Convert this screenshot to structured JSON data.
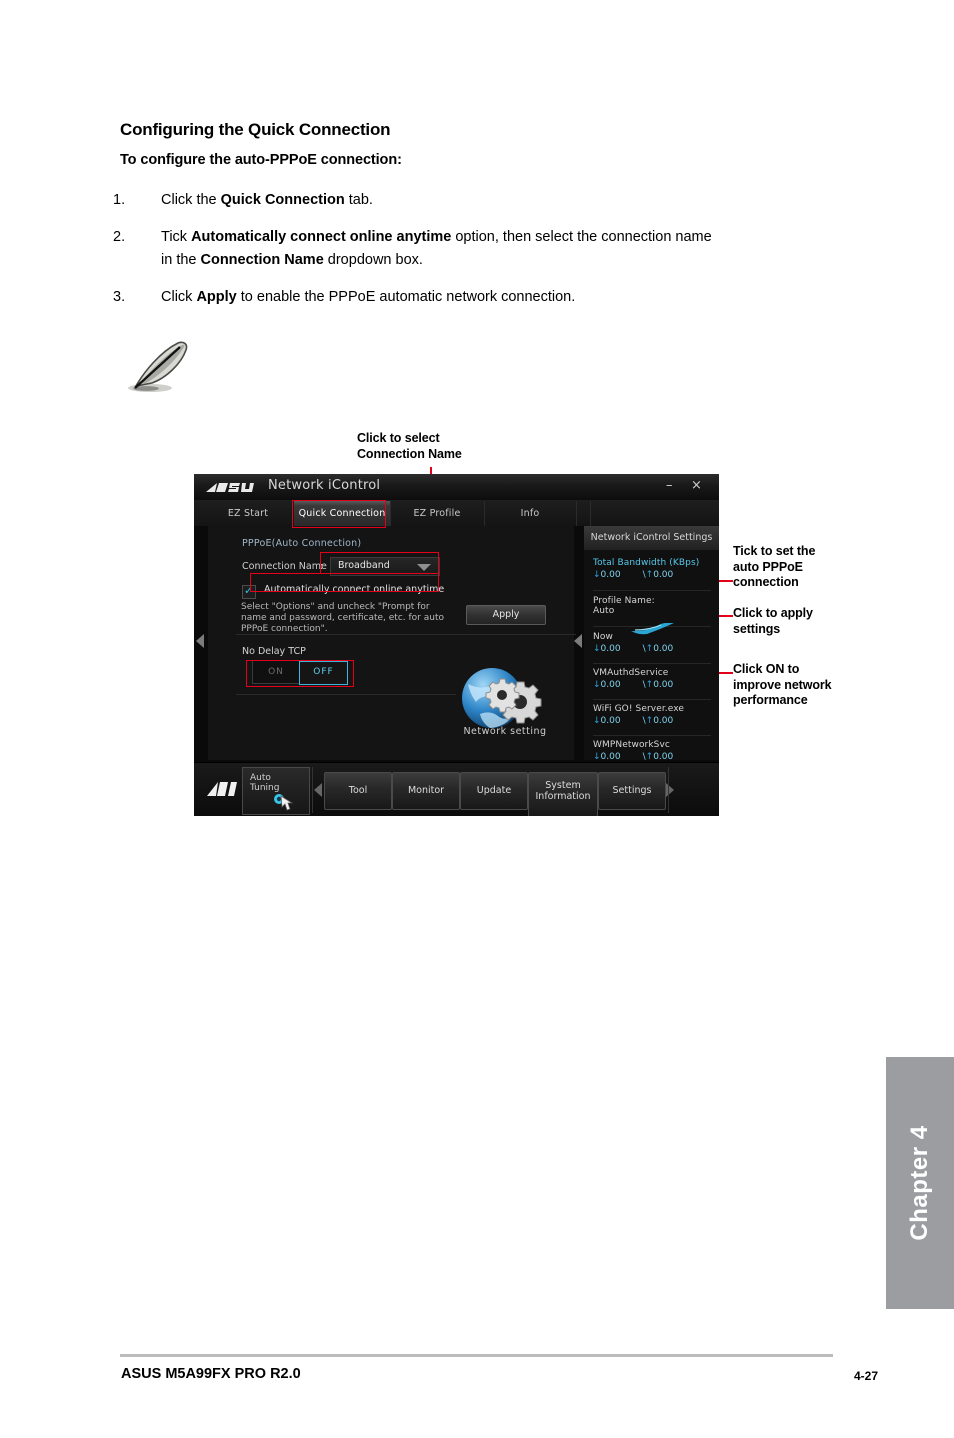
{
  "document": {
    "heading": "Configuring the Quick Connection",
    "subheading": "To configure the auto-PPPoE connection:",
    "steps": [
      {
        "num": "1.",
        "prefix": "Click the ",
        "bold": "Quick Connection",
        "suffix": " tab."
      },
      {
        "num": "2.",
        "prefix": "Tick ",
        "bold": "Automatically connect online anytime",
        "suffix": " option, then select the connection name"
      },
      {
        "num": "3.",
        "prefix": "Click ",
        "bold": "Apply",
        "suffix": " to enable the PPPoE automatic network connection."
      }
    ],
    "step2_line2_prefix": "in the ",
    "step2_line2_bold": "Connection Name",
    "step2_line2_suffix": " dropdown box.",
    "note_icon": "quill-note-icon"
  },
  "callouts": {
    "top": "Click to select\nConnection Name",
    "right1": "Tick to set the\nauto PPPoE\nconnection",
    "right2": "Click to apply\nsettings",
    "right3": "Click ON to\nimprove network\nperformance",
    "line_color": "#e2001a"
  },
  "app": {
    "brand": "ASUS",
    "title": "Network iControl",
    "window_buttons": {
      "minimize": "–",
      "close": "×"
    },
    "tabs": [
      {
        "label": "EZ Start",
        "active": false
      },
      {
        "label": "Quick Connection",
        "active": true
      },
      {
        "label": "EZ Profile",
        "active": false
      },
      {
        "label": "Info",
        "active": false
      }
    ],
    "main": {
      "section_label": "PPPoE(Auto Connection)",
      "connection_name_label": "Connection Name",
      "connection_name_colon": ":",
      "connection_name_value": "Broadband",
      "checkbox_label": "Automatically connect online anytime",
      "checkbox_checked": true,
      "hint": "Select \"Options\" and uncheck \"Prompt for name and password, certificate, etc. for auto PPPoE connection\".",
      "apply_label": "Apply",
      "no_delay_tcp_label": "No Delay TCP",
      "toggle_on": "ON",
      "toggle_off": "OFF",
      "toggle_state": "OFF",
      "network_setting_label": "Network  setting",
      "network_setting_icon": "globe-gears-icon"
    },
    "settings_panel": {
      "header": "Network iControl Settings",
      "items": [
        {
          "name": "Total Bandwidth (KBps)",
          "accent": true,
          "down": "0.00",
          "up": "0.00"
        },
        {
          "name": "Profile Name:",
          "name2": "Auto",
          "accent": false
        },
        {
          "name": "Now",
          "accent": false,
          "down": "0.00",
          "up": "0.00",
          "badge": "flash-icon"
        },
        {
          "name": "VMAuthdService",
          "accent": false,
          "down": "0.00",
          "up": "0.00"
        },
        {
          "name": "WiFi GO! Server.exe",
          "accent": false,
          "down": "0.00",
          "up": "0.00"
        },
        {
          "name": "WMPNetworkSvc",
          "accent": false,
          "down": "0.00",
          "up": "0.00"
        }
      ],
      "down_glyph": "↓",
      "separator_glyph": "\\",
      "up_glyph": "↑"
    },
    "bottom_bar": {
      "logo": "ai-suite-logo",
      "auto_tuning_line1": "Auto",
      "auto_tuning_line2": "Tuning",
      "buttons": [
        {
          "label": "Tool",
          "lines": 1
        },
        {
          "label": "Monitor",
          "lines": 1
        },
        {
          "label": "Update",
          "lines": 1
        },
        {
          "label": "System",
          "label2": "Information",
          "lines": 2
        },
        {
          "label": "Settings",
          "lines": 1
        }
      ]
    }
  },
  "chapter_tab": "Chapter 4",
  "footer": {
    "left": "ASUS M5A99FX PRO R2.0",
    "right": "4-27"
  }
}
